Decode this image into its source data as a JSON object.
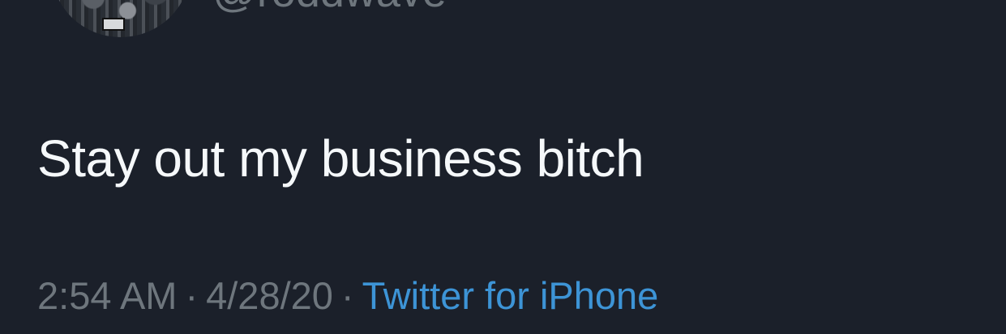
{
  "tweet": {
    "handle": "@roddwave",
    "text": "Stay out my business bitch",
    "time": "2:54 AM",
    "date": "4/28/20",
    "separator": "·",
    "source": "Twitter for iPhone"
  },
  "colors": {
    "background": "#1b202a",
    "text": "#f5f8fa",
    "meta": "#6e767d",
    "link": "#3d94d6"
  }
}
